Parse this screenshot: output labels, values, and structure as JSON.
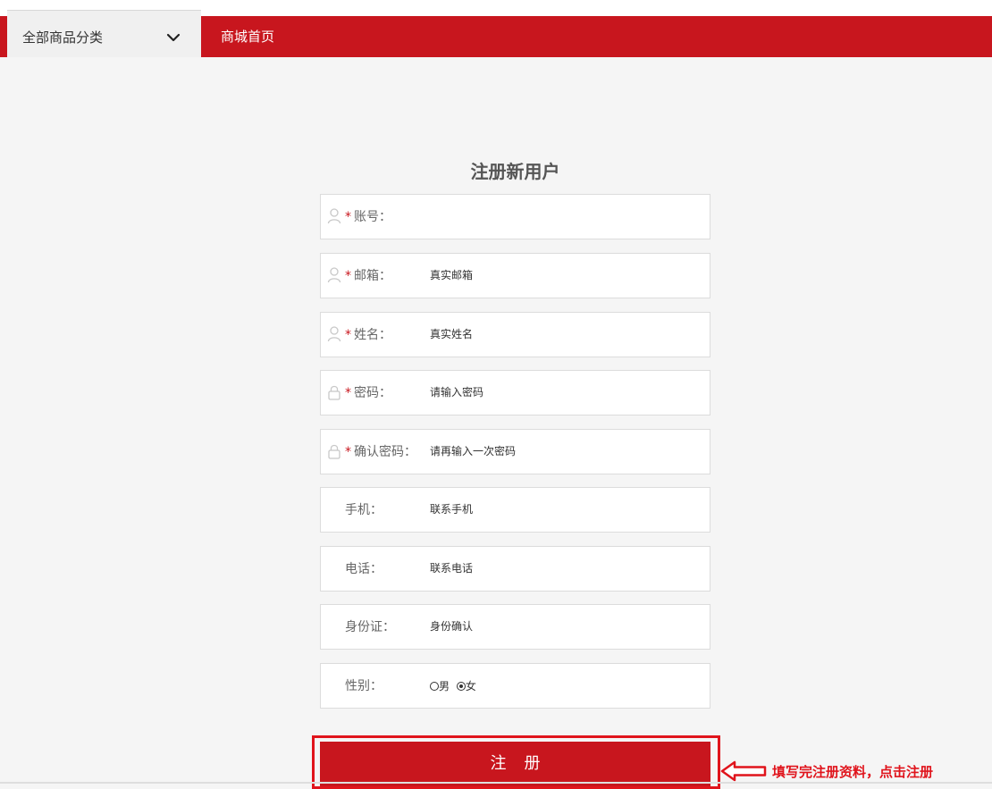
{
  "nav": {
    "category_label": "全部商品分类",
    "home_link": "商城首页"
  },
  "form": {
    "title": "注册新用户",
    "required_mark": "*",
    "fields": [
      {
        "label": "账号：",
        "placeholder": "",
        "icon": "user-icon"
      },
      {
        "label": "邮箱：",
        "placeholder": "真实邮箱",
        "icon": "user-icon"
      },
      {
        "label": "姓名：",
        "placeholder": "真实姓名",
        "icon": "user-icon"
      },
      {
        "label": "密码：",
        "placeholder": "请输入密码",
        "icon": "lock-icon"
      },
      {
        "label": "确认密码：",
        "placeholder": "请再输入一次密码",
        "icon": "lock-icon"
      },
      {
        "label": "手机：",
        "placeholder": "联系手机"
      },
      {
        "label": "电话：",
        "placeholder": "联系电话"
      },
      {
        "label": "身份证：",
        "placeholder": "身份确认"
      }
    ],
    "gender": {
      "label": "性别：",
      "options": [
        "男",
        "女"
      ],
      "selected": "女"
    },
    "submit_label": "注册"
  },
  "annotation": {
    "hint": "填写完注册资料，点击注册"
  },
  "colors": {
    "brand_red": "#c8161e",
    "annotation_red": "#e0141c",
    "background": "#f5f5f5"
  }
}
